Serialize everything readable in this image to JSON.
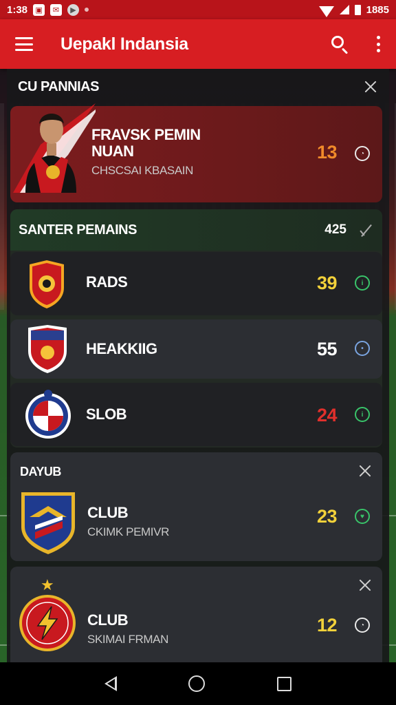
{
  "status_bar": {
    "time": "1:38",
    "battery_text": "1885"
  },
  "app_bar": {
    "title": "Uepakl Indansia"
  },
  "top_section": {
    "title": "CU PANNIAS"
  },
  "featured": {
    "name_line1": "FRAVSK PEMIN",
    "name_line2": "NUAN",
    "subtitle": "CHSCSAI KBASAIN",
    "score": "13",
    "score_color": "#f08a2a"
  },
  "section2": {
    "title": "SANTER PEMAINS",
    "count": "425",
    "rows": [
      {
        "name": "RADS",
        "score": "39",
        "score_color": "#f2d13a",
        "badge_color": "#39c46a"
      },
      {
        "name": "HEAKKIIG",
        "score": "55",
        "score_color": "#ffffff",
        "badge_color": "#7aa4e0"
      },
      {
        "name": "SLOB",
        "score": "24",
        "score_color": "#e0302c",
        "badge_color": "#39c46a"
      }
    ]
  },
  "section3": {
    "title": "DAYUB",
    "club_name": "CLUB",
    "club_sub": "CKIMK PEMIVR",
    "score": "23",
    "score_color": "#f2d13a",
    "badge_color": "#39c46a"
  },
  "section4": {
    "club_name": "CLUB",
    "club_sub": "SKIMAI FRMAN",
    "score": "12",
    "score_color": "#f2d13a"
  }
}
